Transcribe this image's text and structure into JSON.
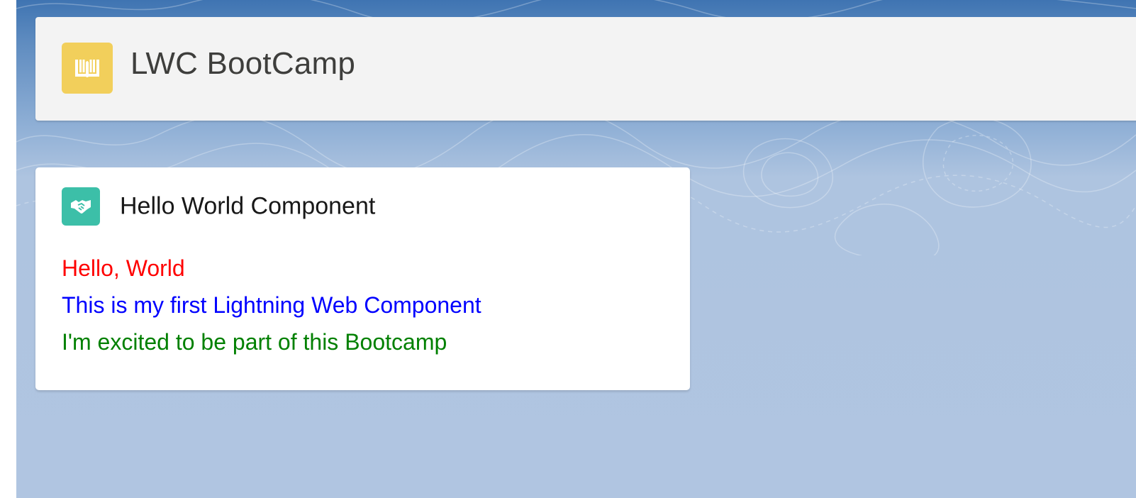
{
  "page_header": {
    "app_icon": "book-icon",
    "app_title": "LWC BootCamp",
    "icon_color": "#f2cf5b"
  },
  "card": {
    "icon": "handshake-icon",
    "icon_color": "#3cbfa8",
    "title": "Hello World Component",
    "lines": [
      {
        "text": "Hello, World",
        "color": "#ff0000"
      },
      {
        "text": "This is my first Lightning Web Component",
        "color": "#0000ff"
      },
      {
        "text": "I'm excited to be part of this Bootcamp",
        "color": "#008000"
      }
    ]
  },
  "colors": {
    "background_top": "#3f74b2",
    "background_bottom": "#b0c5e1",
    "header_bg": "#f3f3f3",
    "card_bg": "#ffffff"
  }
}
